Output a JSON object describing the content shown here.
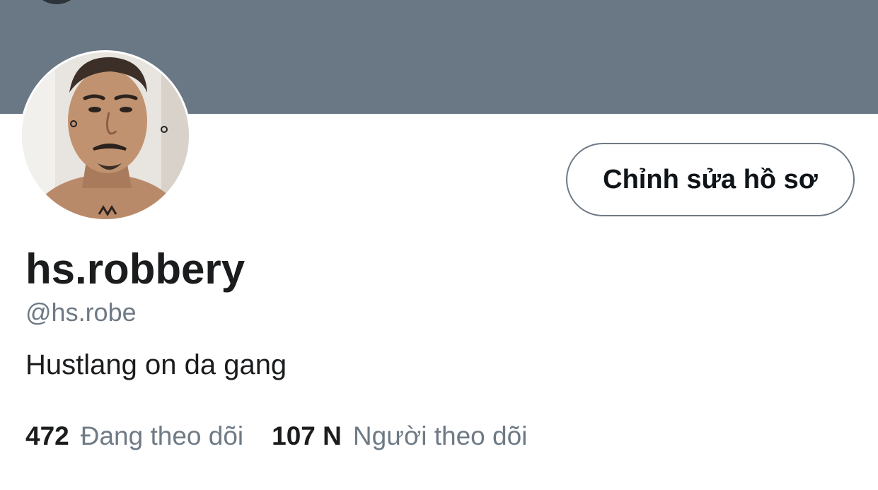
{
  "profile": {
    "display_name": "hs.robbery",
    "handle": "@hs.robe",
    "bio": "Hustlang on da gang",
    "edit_button_label": "Chỉnh sửa hồ sơ"
  },
  "stats": {
    "following_count": "472",
    "following_label": "Đang theo dõi",
    "followers_count": "107 N",
    "followers_label": "Người theo dõi"
  },
  "colors": {
    "banner": "#6a7886",
    "secondary_text": "#6e7a85",
    "primary_text": "#1a1c1e"
  },
  "icons": {
    "back": "back-arrow-icon"
  }
}
